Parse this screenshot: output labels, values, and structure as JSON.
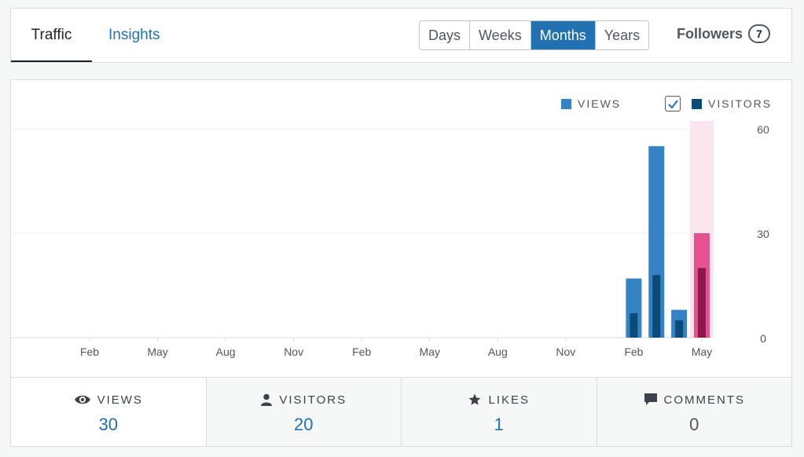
{
  "tabs": {
    "traffic": "Traffic",
    "insights": "Insights"
  },
  "periods": [
    "Days",
    "Weeks",
    "Months",
    "Years"
  ],
  "active_period": "Months",
  "followers": {
    "label": "Followers",
    "count": "7"
  },
  "legend": {
    "views": "VIEWS",
    "visitors": "VISITORS"
  },
  "colors": {
    "views": "#3582c4",
    "visitors": "#0a4b78",
    "selected_views": "#e65290",
    "selected_visitors": "#8c1749",
    "selected_highlight": "#fbe5ee",
    "accent": "#2271b1"
  },
  "chart_data": {
    "type": "bar",
    "categories": [
      "Feb",
      "Mar",
      "Apr",
      "May",
      "Jun",
      "Jul",
      "Aug",
      "Sep",
      "Oct",
      "Nov",
      "Dec",
      "Jan",
      "Feb",
      "Mar",
      "Apr",
      "May",
      "Jun",
      "Jul",
      "Aug",
      "Sep",
      "Oct",
      "Nov",
      "Dec",
      "Jan",
      "Feb",
      "Mar",
      "Apr",
      "May"
    ],
    "x_tick_labels": [
      "Feb",
      "May",
      "Aug",
      "Nov",
      "Feb",
      "May",
      "Aug",
      "Nov",
      "Feb",
      "May"
    ],
    "series": [
      {
        "name": "VIEWS",
        "values": [
          0,
          0,
          0,
          0,
          0,
          0,
          0,
          0,
          0,
          0,
          0,
          0,
          0,
          0,
          0,
          0,
          0,
          0,
          0,
          0,
          0,
          0,
          0,
          0,
          17,
          55,
          8,
          30
        ]
      },
      {
        "name": "VISITORS",
        "values": [
          0,
          0,
          0,
          0,
          0,
          0,
          0,
          0,
          0,
          0,
          0,
          0,
          0,
          0,
          0,
          0,
          0,
          0,
          0,
          0,
          0,
          0,
          0,
          0,
          7,
          18,
          5,
          20
        ]
      }
    ],
    "selected_index": 27,
    "y_ticks": [
      0,
      30,
      60
    ],
    "ylim": [
      0,
      60
    ],
    "grid": true,
    "legend_position": "top-right"
  },
  "summary": [
    {
      "key": "views",
      "label": "VIEWS",
      "value": "30",
      "icon": "eye-icon"
    },
    {
      "key": "visitors",
      "label": "VISITORS",
      "value": "20",
      "icon": "person-icon"
    },
    {
      "key": "likes",
      "label": "LIKES",
      "value": "1",
      "icon": "star-icon"
    },
    {
      "key": "comments",
      "label": "COMMENTS",
      "value": "0",
      "icon": "comment-icon"
    }
  ]
}
